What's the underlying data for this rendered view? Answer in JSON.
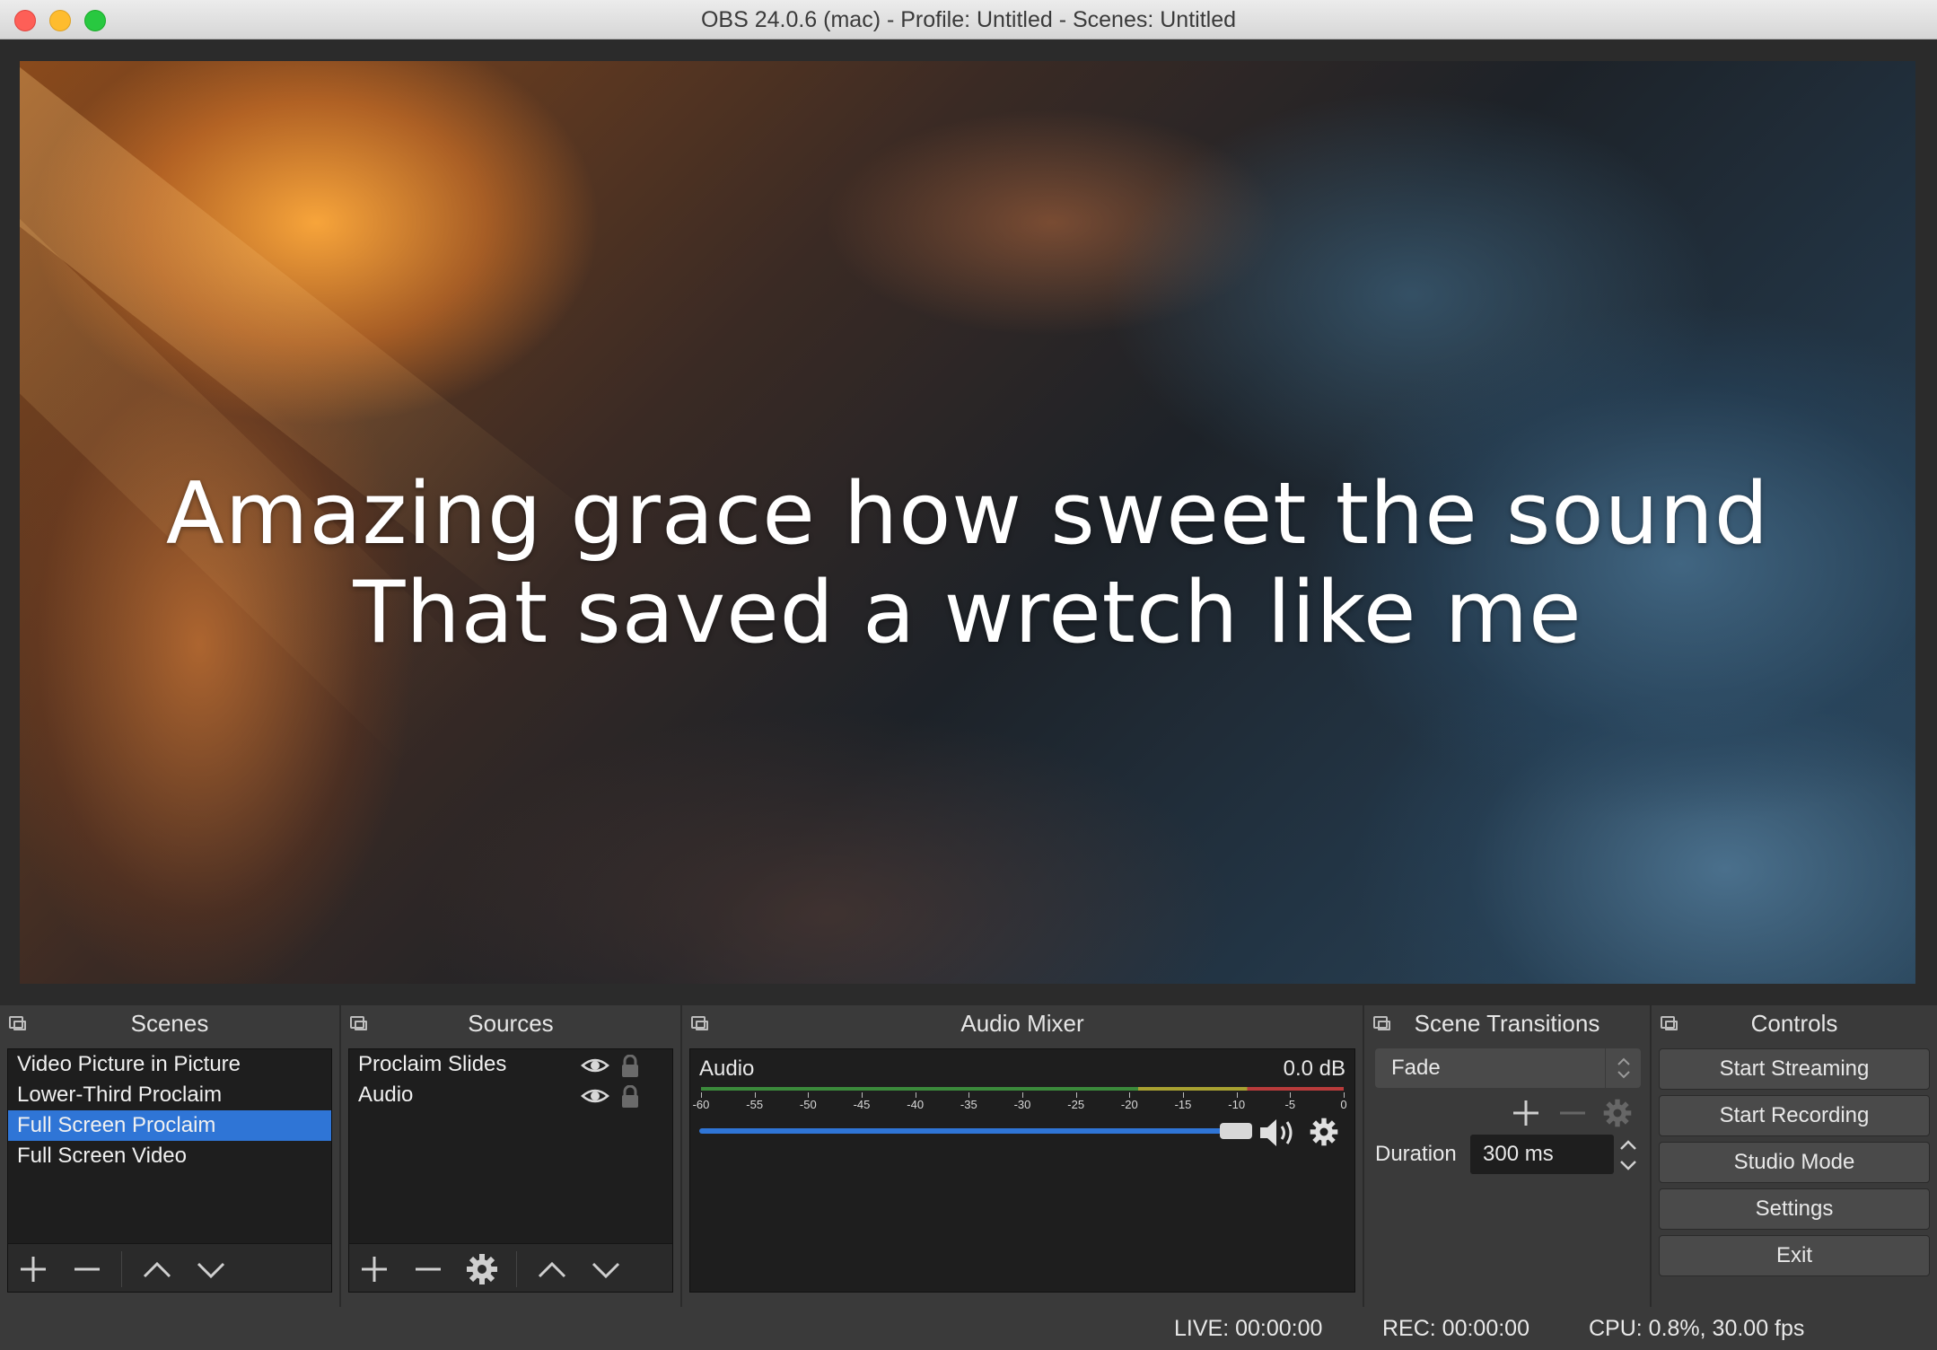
{
  "window": {
    "title": "OBS 24.0.6 (mac) - Profile: Untitled - Scenes: Untitled"
  },
  "preview": {
    "lyrics_line1": "Amazing grace how sweet the sound",
    "lyrics_line2": "That saved a wretch like me"
  },
  "scenes": {
    "title": "Scenes",
    "items": [
      {
        "label": "Video Picture in Picture",
        "selected": false
      },
      {
        "label": "Lower-Third Proclaim",
        "selected": false
      },
      {
        "label": "Full Screen Proclaim",
        "selected": true
      },
      {
        "label": "Full Screen Video",
        "selected": false
      }
    ],
    "toolbar": [
      "plus-icon",
      "minus-icon",
      "chevron-up-icon",
      "chevron-down-icon"
    ]
  },
  "sources": {
    "title": "Sources",
    "items": [
      {
        "label": "Proclaim Slides",
        "visible": true,
        "locked": true
      },
      {
        "label": "Audio",
        "visible": true,
        "locked": true
      }
    ],
    "toolbar": [
      "plus-icon",
      "minus-icon",
      "gear-icon",
      "chevron-up-icon",
      "chevron-down-icon"
    ]
  },
  "audio_mixer": {
    "title": "Audio Mixer",
    "channel_name": "Audio",
    "level": "0.0 dB",
    "volume_fraction": 1.0,
    "tick_labels": [
      "-60",
      "-55",
      "-50",
      "-45",
      "-40",
      "-35",
      "-30",
      "-25",
      "-20",
      "-15",
      "-10",
      "-5",
      "0"
    ]
  },
  "scene_transitions": {
    "title": "Scene Transitions",
    "transition": "Fade",
    "duration_label": "Duration",
    "duration_value": "300 ms"
  },
  "controls": {
    "title": "Controls",
    "buttons": [
      "Start Streaming",
      "Start Recording",
      "Studio Mode",
      "Settings",
      "Exit"
    ]
  },
  "status": {
    "live": "LIVE: 00:00:00",
    "rec": "REC: 00:00:00",
    "cpu": "CPU: 0.8%, 30.00 fps"
  },
  "colors": {
    "selection": "#2f75d6",
    "dock_bg": "#3a3a3a",
    "panel_bg": "#1e1e1e"
  }
}
